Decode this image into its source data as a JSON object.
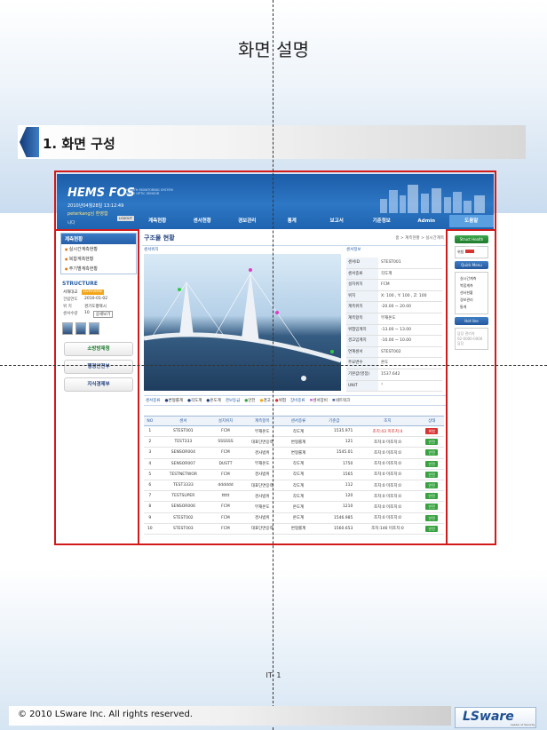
{
  "page_title": "화면 설명",
  "section_title": "1. 화면 구성",
  "page_number": "IT- 1",
  "footer": {
    "copyright": "© 2010 LSware Inc. All rights reserved.",
    "logo": "LSware",
    "logo_sub": "Leader of Security"
  },
  "app": {
    "logo": "HEMS FOS",
    "logo_sub": "HEALTH MONITORING SYSTEM FIBER OPTIC SENSOR",
    "datetime": "2010년04월28일 13:12:49",
    "user": "peterkang님 환영합",
    "logout": "LOGOUT",
    "user_suffix": "니다",
    "nav": [
      "계측현황",
      "센서현황",
      "경보관리",
      "통계",
      "보고서",
      "기준정보",
      "Admin",
      "도움말"
    ],
    "left": {
      "menu_title": "계측현황",
      "menu_items": [
        "실시간계측현황",
        "복합계측현황",
        "주기별계측현황"
      ],
      "structure_label": "STRUCTURE",
      "structure_name": "서해대교",
      "structure_btn": "Overview",
      "info": [
        {
          "k": "건립연도",
          "v": "2010-01-02"
        },
        {
          "k": "위 치",
          "v": "경기도평택시"
        },
        {
          "k": "센서수량",
          "v": "10"
        }
      ],
      "detail_btn": "상세보기",
      "links": [
        "소방방재청",
        "행정안전부",
        "지식경제부"
      ]
    },
    "main": {
      "title": "구조물 현황",
      "breadcrumb": "홈 > 계측현황 > 실시간계측",
      "photo_tab": "센서위치",
      "info_tab": "센서정보",
      "sensor_info": [
        {
          "k": "센서ID",
          "v": "STEST001"
        },
        {
          "k": "센서종류",
          "v": "각도계"
        },
        {
          "k": "설치위치",
          "v": "FCM"
        },
        {
          "k": "위치",
          "v": "X: 100 , Y: 100 , Z: 100"
        },
        {
          "k": "계측위치",
          "v": "-20.00 ~ 20.00"
        },
        {
          "k": "계측항목",
          "v": "부재온도"
        },
        {
          "k": "위험임계치",
          "v": "-13.00 ~ 13.00"
        },
        {
          "k": "경고임계치",
          "v": "-10.00 ~ 10.00"
        },
        {
          "k": "연계센서",
          "v": "STEST002"
        },
        {
          "k": "주요변수",
          "v": "온도"
        },
        {
          "k": "기본값(영점)",
          "v": "1537.642"
        },
        {
          "k": "UNIT",
          "v": "°"
        }
      ],
      "legend": [
        "센서종류",
        "변형률계",
        "각도계",
        "온도계",
        "경보등급",
        "안전",
        "경고",
        "위험",
        "장비종류",
        "센서장비",
        "네트워크"
      ],
      "columns": [
        "NO",
        "센서",
        "설치위치",
        "계측항목",
        "센서종류",
        "기준값",
        "조치",
        "상태"
      ],
      "rows": [
        {
          "no": "1",
          "sensor": "STEST001",
          "loc": "FCM",
          "item": "부재온도",
          "type": "각도계",
          "base": "1535.971",
          "act": "조치:43 미조치:4",
          "state": "위험"
        },
        {
          "no": "2",
          "sensor": "TEST333",
          "loc": "SSSSSS",
          "item": "대표단면응력",
          "type": "변형률계",
          "base": "121",
          "act": "조치:0 미조치:0",
          "state": "안전"
        },
        {
          "no": "3",
          "sensor": "SENSOR004",
          "loc": "FCM",
          "item": "경사범위",
          "type": "변형률계",
          "base": "1545.01",
          "act": "조치:0 미조치:0",
          "state": "안전"
        },
        {
          "no": "4",
          "sensor": "SENSOR007",
          "loc": "DUSTT",
          "item": "부재온도",
          "type": "각도계",
          "base": "1750",
          "act": "조치:0 미조치:0",
          "state": "안전"
        },
        {
          "no": "5",
          "sensor": "TESTNETWOR",
          "loc": "FCM",
          "item": "경사범위",
          "type": "각도계",
          "base": "1565",
          "act": "조치:0 미조치:0",
          "state": "안전"
        },
        {
          "no": "6",
          "sensor": "TEST3333",
          "loc": "dddddd",
          "item": "대표단면응력",
          "type": "각도계",
          "base": "112",
          "act": "조치:0 미조치:0",
          "state": "안전"
        },
        {
          "no": "7",
          "sensor": "TESTSUPER",
          "loc": "ttttt",
          "item": "경사범위",
          "type": "각도계",
          "base": "120",
          "act": "조치:0 미조치:0",
          "state": "안전"
        },
        {
          "no": "8",
          "sensor": "SENSOR006",
          "loc": "FCM",
          "item": "부재온도",
          "type": "온도계",
          "base": "1210",
          "act": "조치:0 미조치:0",
          "state": "안전"
        },
        {
          "no": "9",
          "sensor": "STEST002",
          "loc": "FCM",
          "item": "경사범위",
          "type": "온도계",
          "base": "1546.985",
          "act": "조치:0 미조치:0",
          "state": "안전"
        },
        {
          "no": "10",
          "sensor": "STEST003",
          "loc": "FCM",
          "item": "대표단면응력",
          "type": "변형률계",
          "base": "1560.653",
          "act": "조치:146 미조치:0",
          "state": "안전"
        }
      ]
    },
    "right": {
      "health_btn": "Struct Health Check",
      "health_label": "위험",
      "quick_btn": "Quick Menu",
      "quick_items": [
        "실시간계측",
        "복합계측",
        "센서현황",
        "경보관리",
        "통계"
      ],
      "hotline_btn": "Hot line",
      "hotline_text": "담당 관리자",
      "hotline_phone": "02-0000-0000",
      "hotline_label": "담당"
    }
  }
}
